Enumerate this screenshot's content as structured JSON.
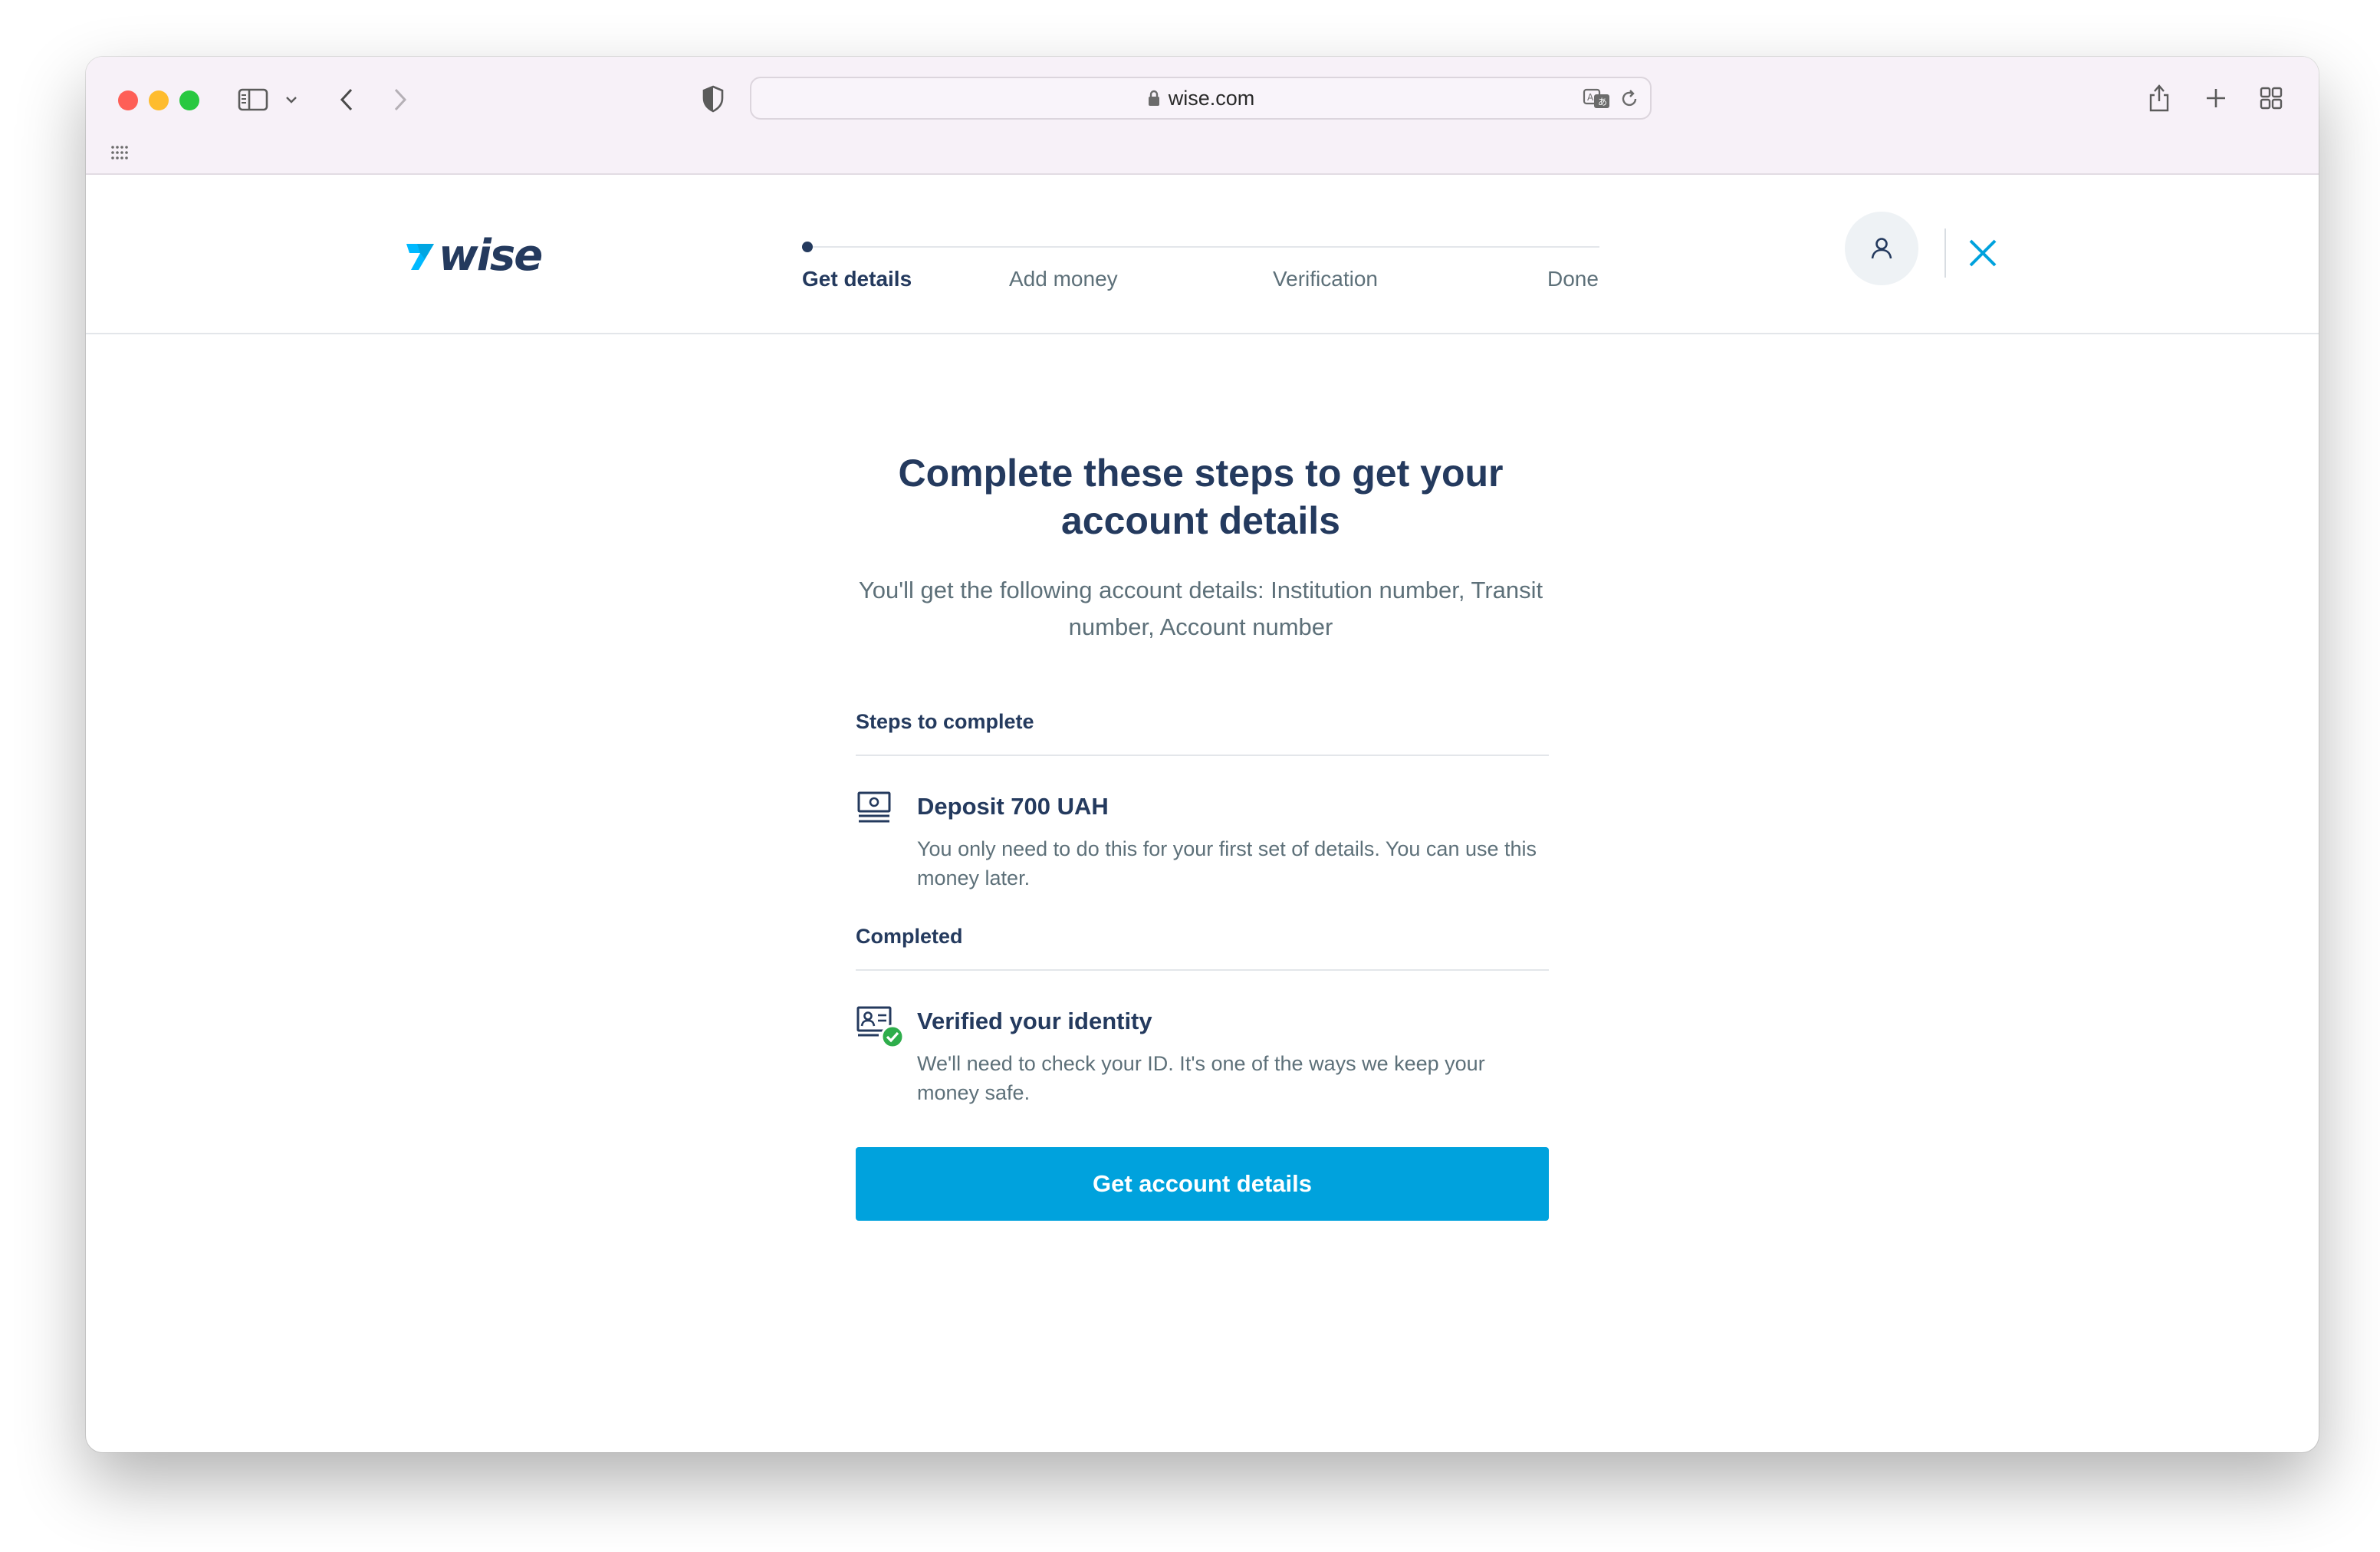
{
  "browser": {
    "url": "wise.com",
    "icons": [
      "sidebar-icon",
      "chevron-down-icon",
      "back-icon",
      "forward-icon",
      "shield-icon",
      "lock-icon",
      "translate-icon",
      "reload-icon",
      "share-icon",
      "new-tab-icon",
      "tab-overview-icon",
      "grid-icon"
    ]
  },
  "header": {
    "logo_text": "wise",
    "steps": [
      {
        "label": "Get details",
        "active": true
      },
      {
        "label": "Add money",
        "active": false
      },
      {
        "label": "Verification",
        "active": false
      },
      {
        "label": "Done",
        "active": false
      }
    ]
  },
  "main": {
    "title": "Complete these steps to get your account details",
    "subtitle": "You'll get the following account details: Institution number, Transit number, Account number",
    "steps_section_label": "Steps to complete",
    "steps_to_complete": [
      {
        "icon": "cash-icon",
        "title": "Deposit 700 UAH",
        "description": "You only need to do this for your first set of details. You can use this money later."
      }
    ],
    "completed_section_label": "Completed",
    "completed": [
      {
        "icon": "id-card-check-icon",
        "title": "Verified your identity",
        "description": "We'll need to check your ID. It's one of the ways we keep your money safe."
      }
    ],
    "cta_label": "Get account details"
  },
  "colors": {
    "brand_navy": "#243a5e",
    "brand_blue": "#00a2dd",
    "success_green": "#2ead4b",
    "muted_text": "#5d7079"
  }
}
